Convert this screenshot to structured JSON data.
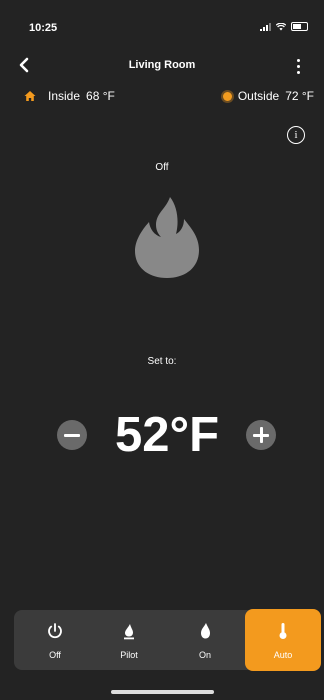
{
  "status_bar": {
    "time": "10:25"
  },
  "header": {
    "title": "Living Room"
  },
  "temperatures": {
    "inside_label": "Inside",
    "inside_value": "68 °F",
    "outside_label": "Outside",
    "outside_value": "72 °F"
  },
  "main": {
    "info_icon": "i",
    "mode_status": "Off",
    "set_to_label": "Set to:",
    "setpoint": "52°F"
  },
  "modes": [
    {
      "label": "Off",
      "icon": "power-icon",
      "selected": false
    },
    {
      "label": "Pilot",
      "icon": "pilot-icon",
      "selected": false
    },
    {
      "label": "On",
      "icon": "flame-icon",
      "selected": false
    },
    {
      "label": "Auto",
      "icon": "thermometer-icon",
      "selected": true
    }
  ],
  "colors": {
    "background": "#232323",
    "accent": "#f39a1e",
    "flame": "#888888",
    "mode_bar": "#3b3b3b"
  }
}
